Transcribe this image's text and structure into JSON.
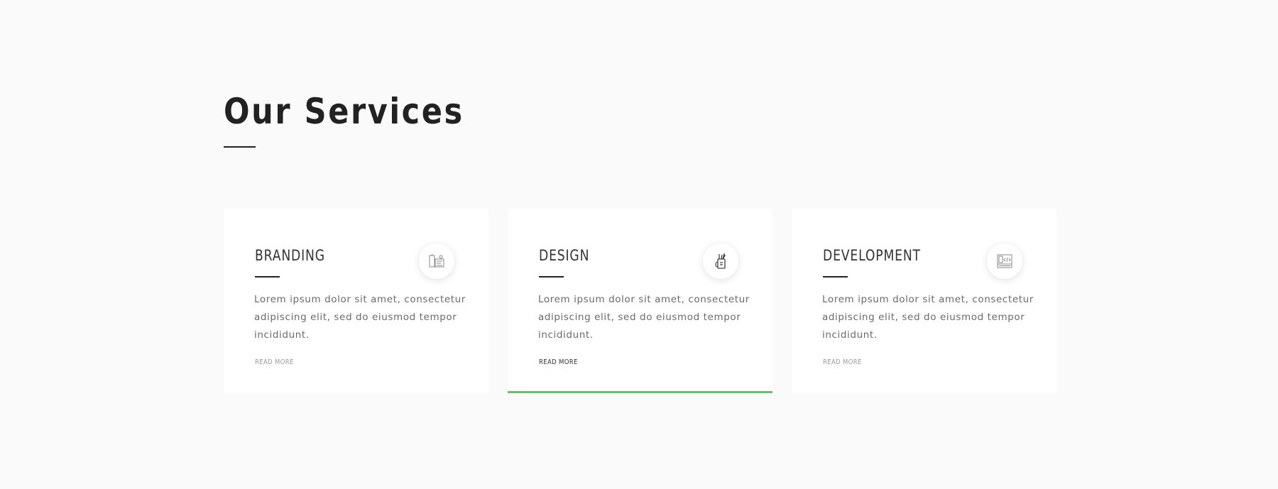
{
  "section": {
    "title": "Our Services"
  },
  "services": [
    {
      "title": "BRANDING",
      "text": "Lorem ipsum dolor sit amet, consectetur adipiscing elit, sed do eiusmod tempor incididunt.",
      "link": "READ MORE",
      "icon": "branding-icon"
    },
    {
      "title": "DESIGN",
      "text": "Lorem ipsum dolor sit amet, consectetur adipiscing elit, sed do eiusmod tempor incididunt.",
      "link": "READ MORE",
      "icon": "design-icon"
    },
    {
      "title": "DEVELOPMENT",
      "text": "Lorem ipsum dolor sit amet, consectetur adipiscing elit, sed do eiusmod tempor incididunt.",
      "link": "READ MORE",
      "icon": "development-icon"
    }
  ],
  "colors": {
    "background": "#fafafa",
    "card": "#ffffff",
    "accent": "#6abf69",
    "heading": "#222222",
    "body_text": "#6a6a6a"
  }
}
